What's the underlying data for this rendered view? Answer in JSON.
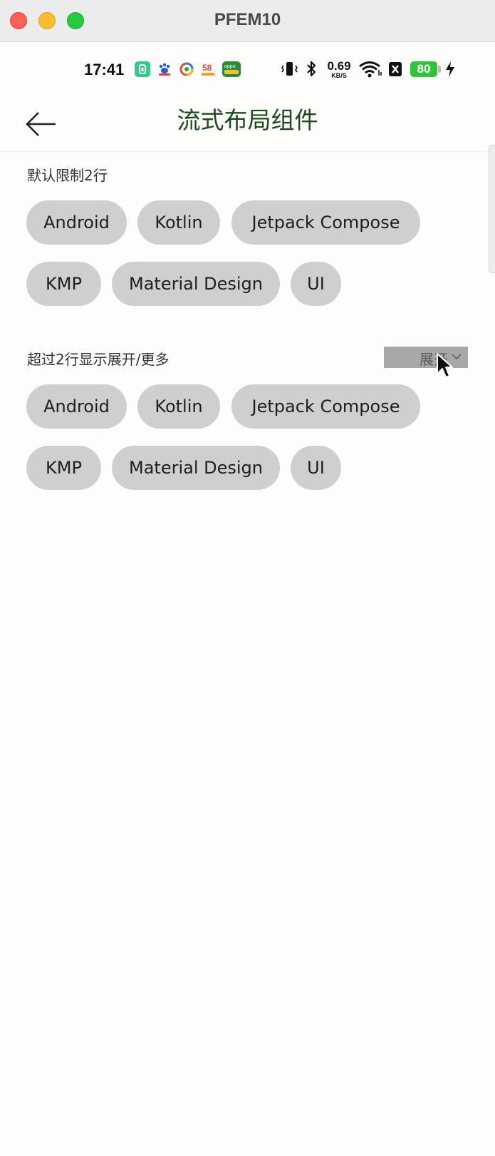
{
  "window": {
    "title": "PFEM10"
  },
  "statusbar": {
    "time": "17:41",
    "net_speed_value": "0.69",
    "net_speed_unit": "KB/S",
    "battery": "80",
    "icons": [
      "app-green-icon",
      "baidu-icon",
      "colorful-app-icon",
      "58-app-icon",
      "oppo-store-icon",
      "vibrate-icon",
      "bluetooth-icon",
      "wifi-icon",
      "sim-off-icon",
      "battery-icon",
      "charging-icon"
    ]
  },
  "appbar": {
    "title": "流式布局组件",
    "back_icon": "arrow-left-icon"
  },
  "sections": [
    {
      "label": "默认限制2行",
      "chips": [
        "Android",
        "Kotlin",
        "Jetpack Compose",
        "KMP",
        "Material Design",
        "UI"
      ]
    },
    {
      "label": "超过2行显示展开/更多",
      "expand_label": "展开",
      "chips": [
        "Android",
        "Kotlin",
        "Jetpack Compose",
        "KMP",
        "Material Design",
        "UI"
      ]
    }
  ],
  "colors": {
    "title_green": "#1d4a1d",
    "chip_bg": "#cfcfcf",
    "battery_green": "#2fc43a",
    "close_red": "#fe5f57",
    "minimize_yellow": "#febc2e",
    "zoom_green": "#28c840"
  }
}
